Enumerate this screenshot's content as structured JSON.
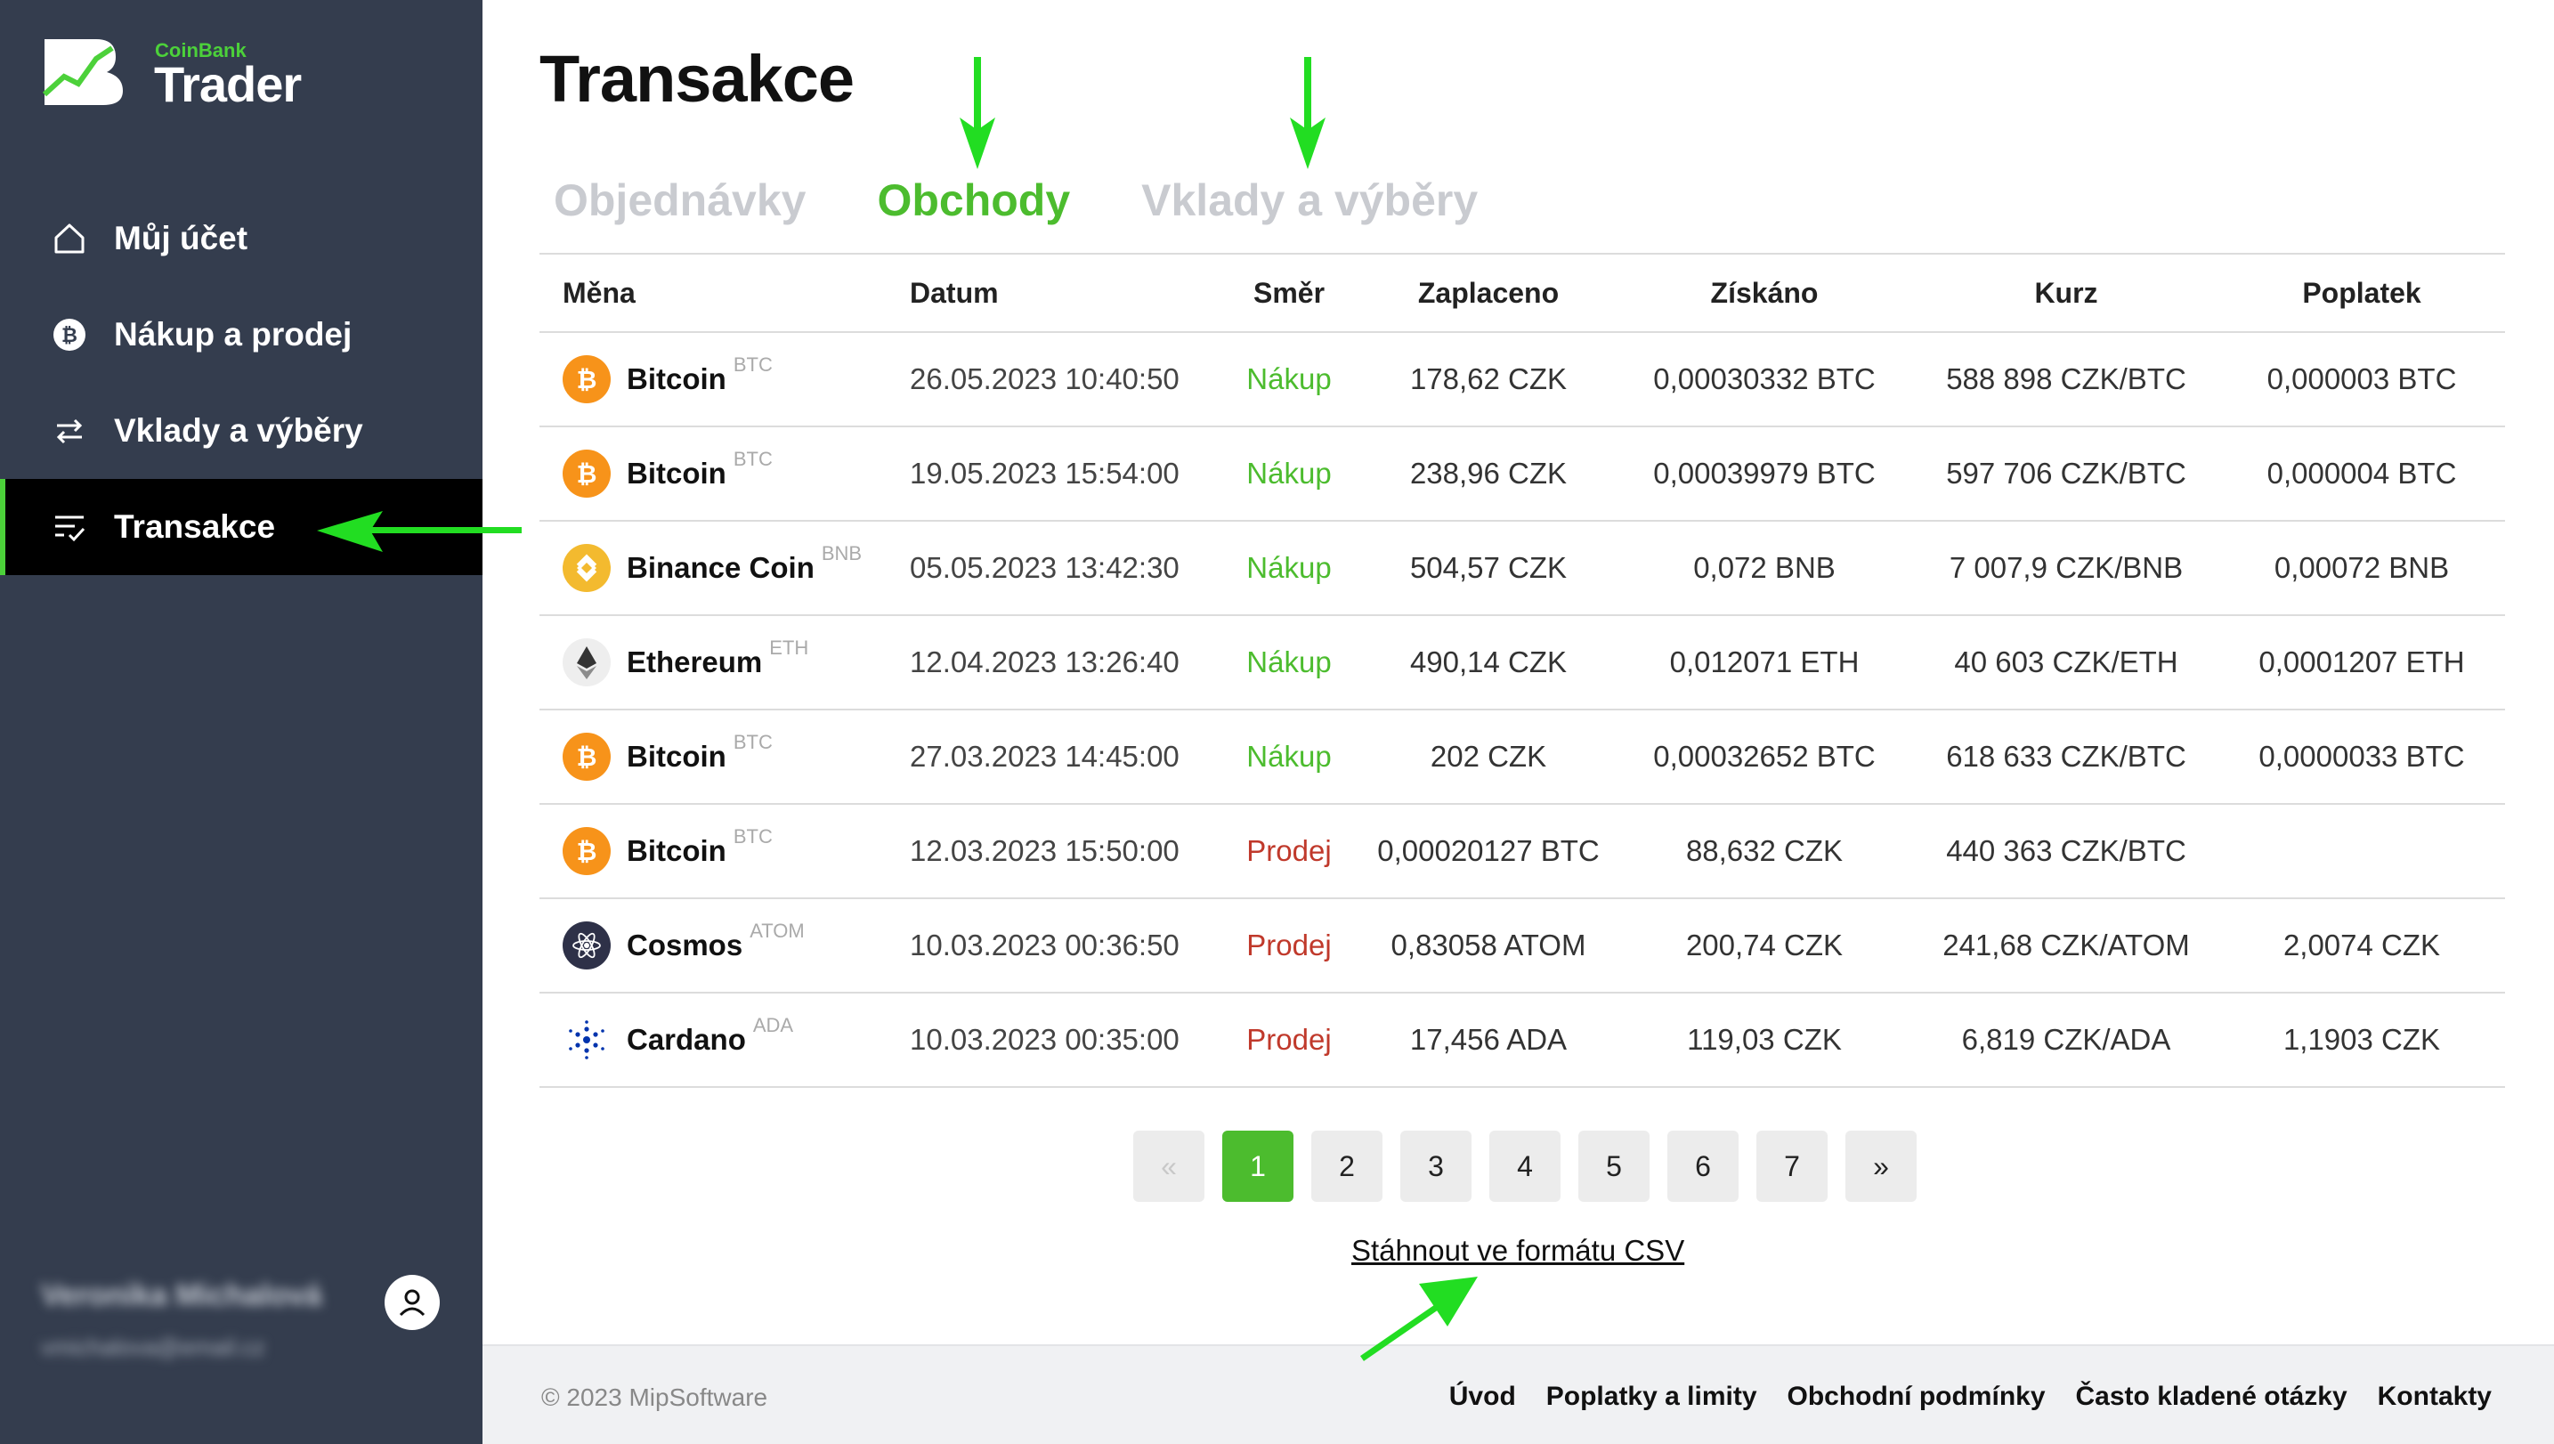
{
  "brand": {
    "small": "CoinBank",
    "big": "Trader",
    "accent": "#4cd13a"
  },
  "sidebar": {
    "items": [
      {
        "label": "Můj účet",
        "icon": "home-icon"
      },
      {
        "label": "Nákup a prodej",
        "icon": "bitcoin-icon"
      },
      {
        "label": "Vklady a výběry",
        "icon": "transfer-arrows-icon"
      },
      {
        "label": "Transakce",
        "icon": "list-check-icon",
        "active": true
      }
    ],
    "user": {
      "name": "Veronika Michalová",
      "email": "vmichalova@email.cz"
    }
  },
  "main": {
    "title": "Transakce",
    "tabs": [
      {
        "label": "Objednávky"
      },
      {
        "label": "Obchody",
        "active": true
      },
      {
        "label": "Vklady a výběry"
      }
    ],
    "table": {
      "headers": [
        "Měna",
        "Datum",
        "Směr",
        "Zaplaceno",
        "Získáno",
        "Kurz",
        "Poplatek"
      ],
      "rows": [
        {
          "coin": "Bitcoin",
          "sym": "BTC",
          "date": "26.05.2023 10:40:50",
          "dir": "Nákup",
          "paid": "178,62 CZK",
          "got": "0,00030332 BTC",
          "rate": "588 898 CZK/BTC",
          "fee": "0,000003 BTC"
        },
        {
          "coin": "Bitcoin",
          "sym": "BTC",
          "date": "19.05.2023 15:54:00",
          "dir": "Nákup",
          "paid": "238,96 CZK",
          "got": "0,00039979 BTC",
          "rate": "597 706 CZK/BTC",
          "fee": "0,000004 BTC"
        },
        {
          "coin": "Binance Coin",
          "sym": "BNB",
          "date": "05.05.2023 13:42:30",
          "dir": "Nákup",
          "paid": "504,57 CZK",
          "got": "0,072 BNB",
          "rate": "7 007,9 CZK/BNB",
          "fee": "0,00072 BNB"
        },
        {
          "coin": "Ethereum",
          "sym": "ETH",
          "date": "12.04.2023 13:26:40",
          "dir": "Nákup",
          "paid": "490,14 CZK",
          "got": "0,012071 ETH",
          "rate": "40 603 CZK/ETH",
          "fee": "0,0001207 ETH"
        },
        {
          "coin": "Bitcoin",
          "sym": "BTC",
          "date": "27.03.2023 14:45:00",
          "dir": "Nákup",
          "paid": "202 CZK",
          "got": "0,00032652 BTC",
          "rate": "618 633 CZK/BTC",
          "fee": "0,0000033 BTC"
        },
        {
          "coin": "Bitcoin",
          "sym": "BTC",
          "date": "12.03.2023 15:50:00",
          "dir": "Prodej",
          "paid": "0,00020127 BTC",
          "got": "88,632 CZK",
          "rate": "440 363 CZK/BTC",
          "fee": ""
        },
        {
          "coin": "Cosmos",
          "sym": "ATOM",
          "date": "10.03.2023 00:36:50",
          "dir": "Prodej",
          "paid": "0,83058 ATOM",
          "got": "200,74 CZK",
          "rate": "241,68 CZK/ATOM",
          "fee": "2,0074 CZK"
        },
        {
          "coin": "Cardano",
          "sym": "ADA",
          "date": "10.03.2023 00:35:00",
          "dir": "Prodej",
          "paid": "17,456 ADA",
          "got": "119,03 CZK",
          "rate": "6,819 CZK/ADA",
          "fee": "1,1903 CZK"
        }
      ]
    },
    "pagination": {
      "prev": "«",
      "pages": [
        "1",
        "2",
        "3",
        "4",
        "5",
        "6",
        "7"
      ],
      "current": "1",
      "next": "»"
    },
    "csv_link": "Stáhnout ve formátu CSV"
  },
  "footer": {
    "copyright": "© 2023 MipSoftware",
    "links": [
      "Úvod",
      "Poplatky a limity",
      "Obchodní podmínky",
      "Často kladené otázky",
      "Kontakty"
    ]
  },
  "colors": {
    "sidebar_bg": "#343d4e",
    "accent_green": "#4cbc2e",
    "sell_red": "#c0392b",
    "btc": "#f7931a",
    "bnb": "#f3ba2f",
    "atom": "#2e3148",
    "ada": "#0033ad",
    "annotation_arrow": "#22dd22"
  }
}
